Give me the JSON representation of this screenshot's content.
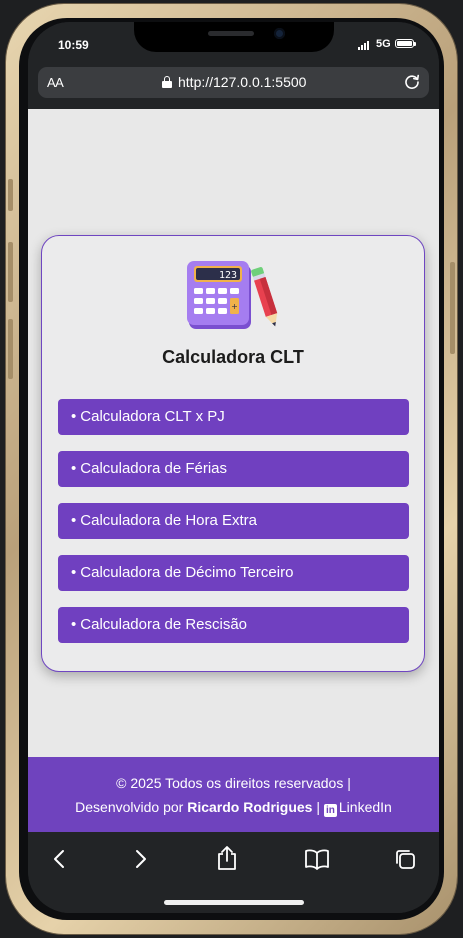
{
  "status_bar": {
    "time": "10:59",
    "network": "5G",
    "icons": [
      "signal-icon",
      "battery-icon"
    ]
  },
  "browser": {
    "text_size_label": "AA",
    "url": "http://127.0.0.1:5500",
    "icons": [
      "lock-icon",
      "reload-icon"
    ]
  },
  "card": {
    "logo_icon": "calculator-pencil-icon",
    "logo_display_value": "123",
    "title": "Calculadora CLT",
    "menu": [
      {
        "bullet": "•",
        "label": "Calculadora CLT x PJ"
      },
      {
        "bullet": "•",
        "label": "Calculadora de Férias"
      },
      {
        "bullet": "•",
        "label": "Calculadora de Hora Extra"
      },
      {
        "bullet": "•",
        "label": "Calculadora de Décimo Terceiro"
      },
      {
        "bullet": "•",
        "label": "Calculadora de Rescisão"
      }
    ]
  },
  "footer": {
    "copyright": "© 2025 Todos os direitos reservados |",
    "developed_by": "Desenvolvido por",
    "author": "Ricardo Rodrigues",
    "separator": "|",
    "linkedin_icon": "in",
    "linkedin_label": "LinkedIn"
  },
  "toolbar": {
    "icons": [
      "back-icon",
      "forward-icon",
      "share-icon",
      "bookmarks-icon",
      "tabs-icon"
    ]
  },
  "colors": {
    "accent": "#7040c0",
    "footer": "#6f43be",
    "page_bg": "#e8e8e8",
    "browser_chrome": "#222426"
  }
}
